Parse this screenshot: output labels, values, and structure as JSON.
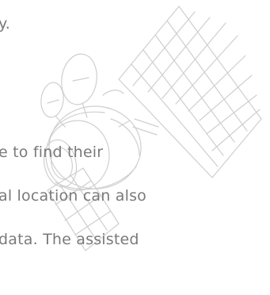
{
  "text": {
    "line1": "y.",
    "line2": "e to find their",
    "line3": "al location can also",
    "line4": "data. The assisted"
  },
  "colors": {
    "text": "#7a7a7a",
    "illustration_stroke": "#cfcfcf",
    "background": "#ffffff"
  },
  "illustration": {
    "icon": "satellite-icon"
  }
}
